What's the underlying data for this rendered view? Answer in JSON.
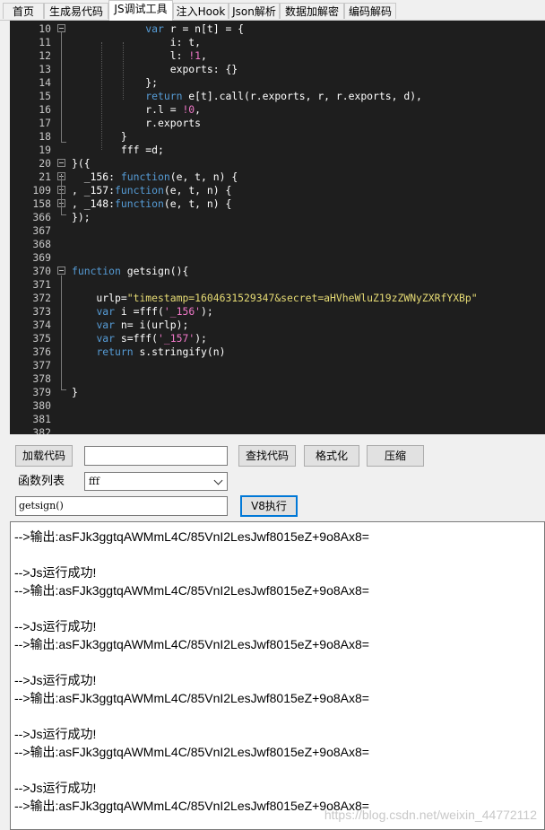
{
  "tabs": [
    "首页",
    "生成易代码",
    "JS调试工具",
    "注入Hook",
    "Json解析",
    "数据加解密",
    "编码解码"
  ],
  "active_tab": "JS调试工具",
  "editor": {
    "lines": [
      {
        "n": "10",
        "code": [
          {
            "t": "            "
          },
          {
            "t": "var",
            "c": "kw"
          },
          {
            "t": " r = n[t] = {"
          }
        ]
      },
      {
        "n": "11",
        "code": [
          {
            "t": "                i: t,"
          }
        ]
      },
      {
        "n": "12",
        "code": [
          {
            "t": "                l: "
          },
          {
            "t": "!1",
            "c": "num"
          },
          {
            "t": ","
          }
        ]
      },
      {
        "n": "13",
        "code": [
          {
            "t": "                exports: {}"
          }
        ]
      },
      {
        "n": "14",
        "code": [
          {
            "t": "            };"
          }
        ]
      },
      {
        "n": "15",
        "code": [
          {
            "t": "            "
          },
          {
            "t": "return",
            "c": "kw"
          },
          {
            "t": " e[t].call(r.exports, r, r.exports, d),"
          }
        ]
      },
      {
        "n": "16",
        "code": [
          {
            "t": "            r.l = "
          },
          {
            "t": "!0",
            "c": "num"
          },
          {
            "t": ","
          }
        ]
      },
      {
        "n": "17",
        "code": [
          {
            "t": "            r.exports"
          }
        ]
      },
      {
        "n": "18",
        "code": [
          {
            "t": "        }"
          }
        ]
      },
      {
        "n": "19",
        "code": [
          {
            "t": "        fff =d;"
          }
        ]
      },
      {
        "n": "20",
        "code": [
          {
            "t": "}({"
          }
        ]
      },
      {
        "n": "21",
        "code": [
          {
            "t": "  _156: "
          },
          {
            "t": "function",
            "c": "kw"
          },
          {
            "t": "(e, t, n) {"
          }
        ]
      },
      {
        "n": "109",
        "code": [
          {
            "t": ", _157:"
          },
          {
            "t": "function",
            "c": "kw"
          },
          {
            "t": "(e, t, n) {"
          }
        ]
      },
      {
        "n": "158",
        "code": [
          {
            "t": ", _148:"
          },
          {
            "t": "function",
            "c": "kw"
          },
          {
            "t": "(e, t, n) {"
          }
        ]
      },
      {
        "n": "366",
        "code": [
          {
            "t": "});"
          }
        ]
      },
      {
        "n": "367",
        "code": []
      },
      {
        "n": "368",
        "code": []
      },
      {
        "n": "369",
        "code": []
      },
      {
        "n": "370",
        "code": [
          {
            "t": "function",
            "c": "kw"
          },
          {
            "t": " getsign(){"
          }
        ]
      },
      {
        "n": "371",
        "code": []
      },
      {
        "n": "372",
        "code": [
          {
            "t": "    urlp="
          },
          {
            "t": "\"timestamp=1604631529347&secret=aHVheWluZ19zZWNyZXRfYXBp\"",
            "c": "str"
          }
        ]
      },
      {
        "n": "373",
        "code": [
          {
            "t": "    "
          },
          {
            "t": "var",
            "c": "kw"
          },
          {
            "t": " i =fff("
          },
          {
            "t": "'_156'",
            "c": "num"
          },
          {
            "t": ");"
          }
        ]
      },
      {
        "n": "374",
        "code": [
          {
            "t": "    "
          },
          {
            "t": "var",
            "c": "kw"
          },
          {
            "t": " n= i(urlp);"
          }
        ]
      },
      {
        "n": "375",
        "code": [
          {
            "t": "    "
          },
          {
            "t": "var",
            "c": "kw"
          },
          {
            "t": " s=fff("
          },
          {
            "t": "'_157'",
            "c": "num"
          },
          {
            "t": ");"
          }
        ]
      },
      {
        "n": "376",
        "code": [
          {
            "t": "    "
          },
          {
            "t": "return",
            "c": "kw"
          },
          {
            "t": " s.stringify(n)"
          }
        ]
      },
      {
        "n": "377",
        "code": []
      },
      {
        "n": "378",
        "code": []
      },
      {
        "n": "379",
        "code": [
          {
            "t": "}"
          }
        ]
      },
      {
        "n": "380",
        "code": []
      },
      {
        "n": "381",
        "code": []
      },
      {
        "n": "382",
        "code": []
      }
    ]
  },
  "controls": {
    "load_code": "加载代码",
    "search_value": "",
    "find_code": "查找代码",
    "format": "格式化",
    "compress": "压缩",
    "func_list_label": "函数列表",
    "func_selected": "fff",
    "call_input": "getsign()",
    "v8_run": "V8执行"
  },
  "output": {
    "lines": [
      "-->输出:asFJk3ggtqAWMmL4C/85VnI2LesJwf8015eZ+9o8Ax8=",
      "",
      "-->Js运行成功!",
      "-->输出:asFJk3ggtqAWMmL4C/85VnI2LesJwf8015eZ+9o8Ax8=",
      "",
      "-->Js运行成功!",
      "-->输出:asFJk3ggtqAWMmL4C/85VnI2LesJwf8015eZ+9o8Ax8=",
      "",
      "-->Js运行成功!",
      "-->输出:asFJk3ggtqAWMmL4C/85VnI2LesJwf8015eZ+9o8Ax8=",
      "",
      "-->Js运行成功!",
      "-->输出:asFJk3ggtqAWMmL4C/85VnI2LesJwf8015eZ+9o8Ax8=",
      "",
      "-->Js运行成功!",
      "-->输出:asFJk3ggtqAWMmL4C/85VnI2LesJwf8015eZ+9o8Ax8="
    ],
    "watermark": "https://blog.csdn.net/weixin_44772112"
  }
}
